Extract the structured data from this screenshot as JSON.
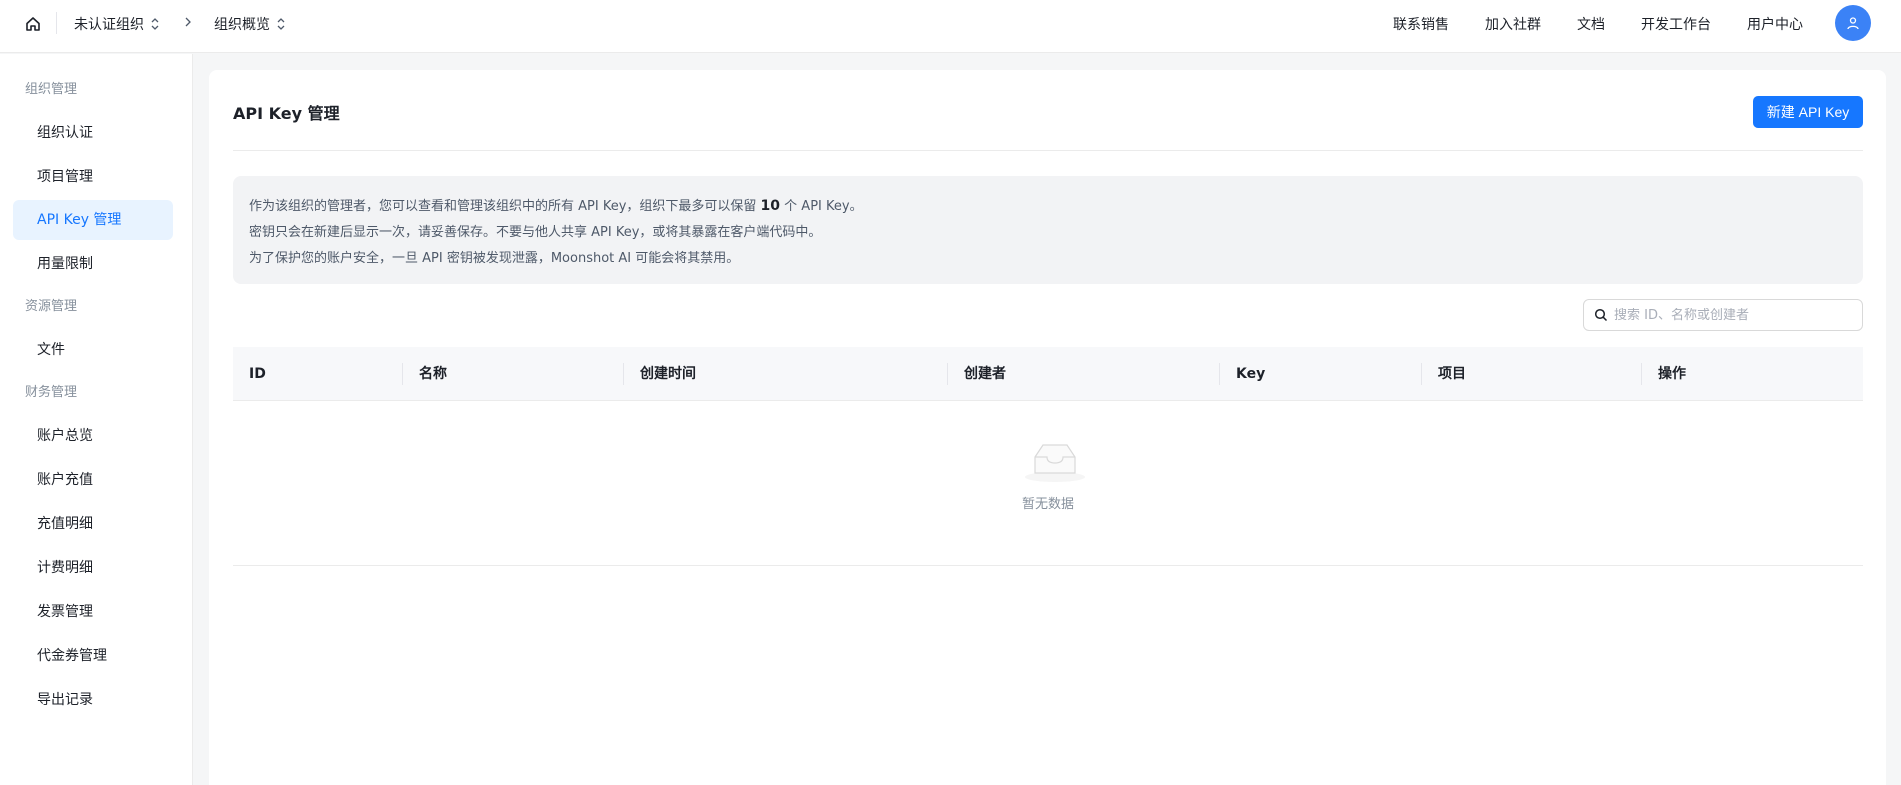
{
  "header": {
    "breadcrumb": [
      {
        "label": "未认证组织"
      },
      {
        "label": "组织概览"
      }
    ],
    "nav": [
      "联系销售",
      "加入社群",
      "文档",
      "开发工作台",
      "用户中心"
    ]
  },
  "sidebar": {
    "groups": [
      {
        "label": "组织管理",
        "items": [
          "组织认证",
          "项目管理",
          "API Key 管理",
          "用量限制"
        ]
      },
      {
        "label": "资源管理",
        "items": [
          "文件"
        ]
      },
      {
        "label": "财务管理",
        "items": [
          "账户总览",
          "账户充值",
          "充值明细",
          "计费明细",
          "发票管理",
          "代金券管理",
          "导出记录"
        ]
      }
    ],
    "active_item": "API Key 管理"
  },
  "main": {
    "title": "API Key 管理",
    "new_button": "新建 API Key",
    "notice": {
      "line1_pre": "作为该组织的管理者，您可以查看和管理该组织中的所有 API Key，组织下最多可以保留 ",
      "line1_count": "10",
      "line1_post": " 个 API Key。",
      "line2": "密钥只会在新建后显示一次，请妥善保存。不要与他人共享 API Key，或将其暴露在客户端代码中。",
      "line3": "为了保护您的账户安全，一旦 API 密钥被发现泄露，Moonshot AI 可能会将其禁用。"
    },
    "search": {
      "placeholder": "搜索 ID、名称或创建者",
      "value": ""
    },
    "table": {
      "columns": [
        "ID",
        "名称",
        "创建时间",
        "创建者",
        "Key",
        "项目",
        "操作"
      ],
      "rows": [],
      "empty_text": "暂无数据"
    }
  },
  "colors": {
    "accent": "#1677ff",
    "avatar": "#3b82f6",
    "active_bg": "#e8f3ff"
  }
}
